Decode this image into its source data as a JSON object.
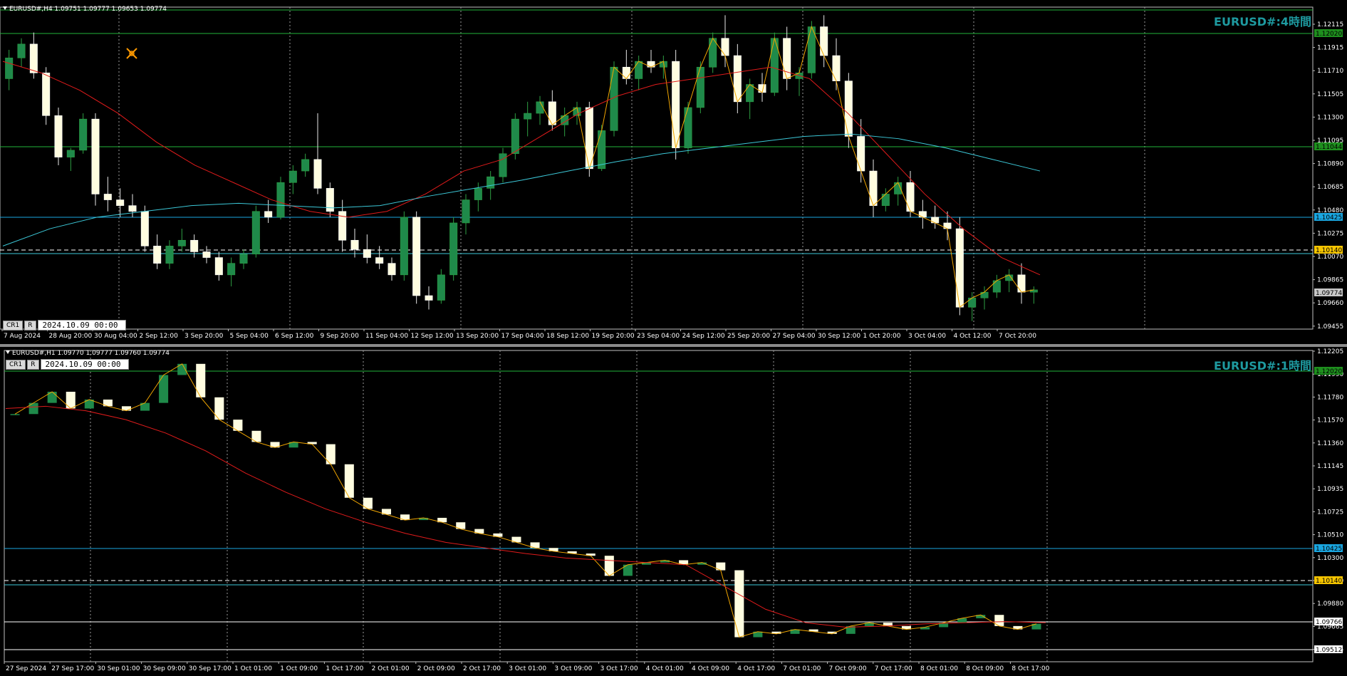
{
  "h4": {
    "header": "EURUSD#,H4  1.09751 1.09777 1.09653 1.09774",
    "watermark": "EURUSD#:4時間",
    "buttons": {
      "cr1": "CR1",
      "r": "R"
    },
    "date_value": "2024.10.09 00:00",
    "price_ticks": [
      "1.12115",
      "1.11915",
      "1.11710",
      "1.11505",
      "1.11300",
      "1.11095",
      "1.10890",
      "1.10685",
      "1.10480",
      "1.10275",
      "1.10070",
      "1.09865",
      "1.09660",
      "1.09455"
    ],
    "time_ticks": [
      "7 Aug 2024",
      "28 Aug 20:00",
      "30 Aug 04:00",
      "2 Sep 12:00",
      "3 Sep 20:00",
      "5 Sep 04:00",
      "6 Sep 12:00",
      "9 Sep 20:00",
      "11 Sep 04:00",
      "12 Sep 12:00",
      "13 Sep 20:00",
      "17 Sep 04:00",
      "18 Sep 12:00",
      "19 Sep 20:00",
      "23 Sep 04:00",
      "24 Sep 12:00",
      "25 Sep 20:00",
      "27 Sep 04:00",
      "30 Sep 12:00",
      "1 Oct 20:00",
      "3 Oct 04:00",
      "4 Oct 12:00",
      "7 Oct 20:00"
    ],
    "level_tags": [
      {
        "text": "1.12020",
        "color": "#1e8f1e",
        "fg": "#000000"
      },
      {
        "text": "1.11044",
        "color": "#1e8f1e",
        "fg": "#000000"
      },
      {
        "text": "1.10425",
        "color": "#1aa6e0",
        "fg": "#000000"
      },
      {
        "text": "1.10140",
        "color": "#f5c400",
        "fg": "#000000"
      },
      {
        "text": "1.09774",
        "color": "#c8c8c8",
        "fg": "#000000"
      }
    ],
    "price_range": [
      1.0943,
      1.1222
    ],
    "candles": [
      [
        1.116,
        1.1185,
        1.115,
        1.1178
      ],
      [
        1.1178,
        1.1195,
        1.117,
        1.119
      ],
      [
        1.119,
        1.12,
        1.116,
        1.1165
      ],
      [
        1.1165,
        1.117,
        1.112,
        1.1128
      ],
      [
        1.1128,
        1.1135,
        1.1085,
        1.1092
      ],
      [
        1.1092,
        1.11,
        1.108,
        1.1098
      ],
      [
        1.1098,
        1.113,
        1.1095,
        1.1125
      ],
      [
        1.1125,
        1.113,
        1.105,
        1.106
      ],
      [
        1.106,
        1.1075,
        1.1045,
        1.1055
      ],
      [
        1.1055,
        1.1065,
        1.104,
        1.105
      ],
      [
        1.105,
        1.106,
        1.104,
        1.1045
      ],
      [
        1.1045,
        1.105,
        1.101,
        1.1015
      ],
      [
        1.1015,
        1.1025,
        1.0995,
        1.1
      ],
      [
        1.1,
        1.102,
        1.0995,
        1.1015
      ],
      [
        1.1015,
        1.103,
        1.101,
        1.102
      ],
      [
        1.102,
        1.1025,
        1.1005,
        1.101
      ],
      [
        1.101,
        1.1015,
        1.1,
        1.1005
      ],
      [
        1.1005,
        1.101,
        1.0985,
        1.099
      ],
      [
        1.099,
        1.1005,
        1.098,
        1.1
      ],
      [
        1.1,
        1.1012,
        1.0995,
        1.1008
      ],
      [
        1.1008,
        1.105,
        1.1005,
        1.1045
      ],
      [
        1.1045,
        1.1055,
        1.1035,
        1.104
      ],
      [
        1.104,
        1.1075,
        1.1038,
        1.107
      ],
      [
        1.107,
        1.1085,
        1.106,
        1.108
      ],
      [
        1.108,
        1.1095,
        1.1075,
        1.109
      ],
      [
        1.109,
        1.113,
        1.106,
        1.1065
      ],
      [
        1.1065,
        1.107,
        1.104,
        1.1045
      ],
      [
        1.1045,
        1.1055,
        1.101,
        1.102
      ],
      [
        1.102,
        1.103,
        1.1005,
        1.1012
      ],
      [
        1.1012,
        1.1025,
        1.1,
        1.1005
      ],
      [
        1.1005,
        1.1015,
        1.0995,
        1.1
      ],
      [
        1.1,
        1.1005,
        1.0985,
        1.099
      ],
      [
        1.099,
        1.1045,
        1.0985,
        1.104
      ],
      [
        1.104,
        1.1045,
        1.0965,
        1.0972
      ],
      [
        1.0972,
        1.098,
        1.096,
        1.0968
      ],
      [
        1.0968,
        1.0995,
        1.0965,
        1.099
      ],
      [
        1.099,
        1.104,
        1.0985,
        1.1035
      ],
      [
        1.1035,
        1.106,
        1.1025,
        1.1055
      ],
      [
        1.1055,
        1.107,
        1.1045,
        1.1065
      ],
      [
        1.1065,
        1.108,
        1.1055,
        1.1075
      ],
      [
        1.1075,
        1.11,
        1.107,
        1.1095
      ],
      [
        1.1095,
        1.113,
        1.109,
        1.1125
      ],
      [
        1.1125,
        1.114,
        1.111,
        1.113
      ],
      [
        1.113,
        1.1145,
        1.112,
        1.114
      ],
      [
        1.114,
        1.115,
        1.1115,
        1.112
      ],
      [
        1.112,
        1.1135,
        1.111,
        1.1128
      ],
      [
        1.1128,
        1.114,
        1.112,
        1.1135
      ],
      [
        1.1135,
        1.114,
        1.1075,
        1.1082
      ],
      [
        1.1082,
        1.112,
        1.108,
        1.1115
      ],
      [
        1.1115,
        1.1175,
        1.111,
        1.117
      ],
      [
        1.117,
        1.1185,
        1.1155,
        1.116
      ],
      [
        1.116,
        1.118,
        1.115,
        1.1175
      ],
      [
        1.1175,
        1.1185,
        1.1165,
        1.117
      ],
      [
        1.117,
        1.118,
        1.116,
        1.1175
      ],
      [
        1.1175,
        1.1185,
        1.109,
        1.11
      ],
      [
        1.11,
        1.114,
        1.1095,
        1.1135
      ],
      [
        1.1135,
        1.1175,
        1.113,
        1.117
      ],
      [
        1.117,
        1.12,
        1.1165,
        1.1195
      ],
      [
        1.1195,
        1.1215,
        1.117,
        1.118
      ],
      [
        1.118,
        1.119,
        1.113,
        1.114
      ],
      [
        1.114,
        1.116,
        1.1125,
        1.1155
      ],
      [
        1.1155,
        1.1165,
        1.114,
        1.1148
      ],
      [
        1.1148,
        1.12,
        1.1145,
        1.1195
      ],
      [
        1.1195,
        1.1205,
        1.115,
        1.116
      ],
      [
        1.116,
        1.117,
        1.1145,
        1.1165
      ],
      [
        1.1165,
        1.121,
        1.116,
        1.1205
      ],
      [
        1.1205,
        1.1215,
        1.117,
        1.118
      ],
      [
        1.118,
        1.1195,
        1.115,
        1.1158
      ],
      [
        1.1158,
        1.1165,
        1.11,
        1.111
      ],
      [
        1.111,
        1.1125,
        1.107,
        1.108
      ],
      [
        1.108,
        1.109,
        1.104,
        1.105
      ],
      [
        1.105,
        1.1065,
        1.1045,
        1.106
      ],
      [
        1.106,
        1.1075,
        1.105,
        1.107
      ],
      [
        1.107,
        1.108,
        1.104,
        1.1045
      ],
      [
        1.1045,
        1.1055,
        1.103,
        1.104
      ],
      [
        1.104,
        1.105,
        1.103,
        1.1035
      ],
      [
        1.1035,
        1.1045,
        1.102,
        1.103
      ],
      [
        1.103,
        1.104,
        1.0955,
        1.0962
      ],
      [
        1.0962,
        1.0975,
        1.095,
        1.097
      ],
      [
        1.097,
        1.098,
        1.096,
        1.0975
      ],
      [
        1.0975,
        1.099,
        1.097,
        1.0985
      ],
      [
        1.0985,
        1.0995,
        1.0975,
        1.099
      ],
      [
        1.099,
        1.1,
        1.0965,
        1.0975
      ],
      [
        1.0975,
        1.098,
        1.0965,
        1.0977
      ]
    ],
    "ma_red": [
      1.1175,
      1.1165,
      1.115,
      1.113,
      1.1105,
      1.1085,
      1.107,
      1.1055,
      1.1045,
      1.104,
      1.1045,
      1.106,
      1.108,
      1.109,
      1.111,
      1.113,
      1.1145,
      1.1155,
      1.116,
      1.1165,
      1.117,
      1.116,
      1.113,
      1.1095,
      1.106,
      1.103,
      1.1005,
      1.099
    ],
    "ma_cyan": [
      1.1015,
      1.103,
      1.104,
      1.1045,
      1.105,
      1.1052,
      1.105,
      1.1048,
      1.105,
      1.1058,
      1.1065,
      1.1072,
      1.108,
      1.1088,
      1.1095,
      1.11,
      1.1105,
      1.111,
      1.1112,
      1.1108,
      1.11,
      1.109,
      1.108
    ]
  },
  "h1": {
    "header": "EURUSD#,H1  1.09770 1.09777 1.09760 1.09774",
    "watermark": "EURUSD#:1時間",
    "buttons": {
      "cr1": "CR1",
      "r": "R"
    },
    "date_value": "2024.10.09 00:00",
    "price_ticks": [
      "1.12205",
      "1.11990",
      "1.11780",
      "1.11570",
      "1.11360",
      "1.11145",
      "1.10935",
      "1.10725",
      "1.10510",
      "1.10300",
      "1.10090",
      "1.09880",
      "1.09665",
      "1.09455"
    ],
    "time_ticks": [
      "27 Sep 2024",
      "27 Sep 17:00",
      "30 Sep 01:00",
      "30 Sep 09:00",
      "30 Sep 17:00",
      "1 Oct 01:00",
      "1 Oct 09:00",
      "1 Oct 17:00",
      "2 Oct 01:00",
      "2 Oct 09:00",
      "2 Oct 17:00",
      "3 Oct 01:00",
      "3 Oct 09:00",
      "3 Oct 17:00",
      "4 Oct 01:00",
      "4 Oct 09:00",
      "4 Oct 17:00",
      "7 Oct 01:00",
      "7 Oct 09:00",
      "7 Oct 17:00",
      "8 Oct 01:00",
      "8 Oct 09:00",
      "8 Oct 17:00"
    ],
    "level_tags": [
      {
        "text": "1.12020",
        "color": "#1e8f1e",
        "fg": "#000000"
      },
      {
        "text": "1.10425",
        "color": "#1aa6e0",
        "fg": "#000000"
      },
      {
        "text": "1.10140",
        "color": "#f5c400",
        "fg": "#000000"
      },
      {
        "text": "1.09766",
        "color": "#ffffff",
        "fg": "#000000"
      },
      {
        "text": "1.09512",
        "color": "#ffffff",
        "fg": "#000000"
      }
    ],
    "price_range": [
      1.0943,
      1.1222
    ],
    "close_path": [
      1.1165,
      1.1175,
      1.1185,
      1.117,
      1.1178,
      1.1172,
      1.1168,
      1.1175,
      1.12,
      1.121,
      1.118,
      1.116,
      1.115,
      1.114,
      1.1135,
      1.114,
      1.1138,
      1.112,
      1.109,
      1.108,
      1.1075,
      1.107,
      1.1072,
      1.1068,
      1.1062,
      1.1058,
      1.1055,
      1.105,
      1.1045,
      1.1042,
      1.104,
      1.1038,
      1.102,
      1.103,
      1.1032,
      1.1034,
      1.103,
      1.1032,
      1.1025,
      1.0965,
      1.097,
      1.0968,
      1.0972,
      1.097,
      1.0968,
      1.0975,
      1.0978,
      1.0975,
      1.0972,
      1.0974,
      1.0978,
      1.0982,
      1.0985,
      1.0975,
      1.0972,
      1.0977
    ],
    "ma_red": [
      1.117,
      1.1172,
      1.1168,
      1.116,
      1.1148,
      1.1132,
      1.1112,
      1.1095,
      1.108,
      1.1068,
      1.1058,
      1.105,
      1.1045,
      1.104,
      1.1036,
      1.1034,
      1.1032,
      1.103,
      1.101,
      1.099,
      1.0978,
      1.0974,
      1.0975,
      1.0977,
      1.0978,
      1.0979,
      1.0978
    ]
  }
}
